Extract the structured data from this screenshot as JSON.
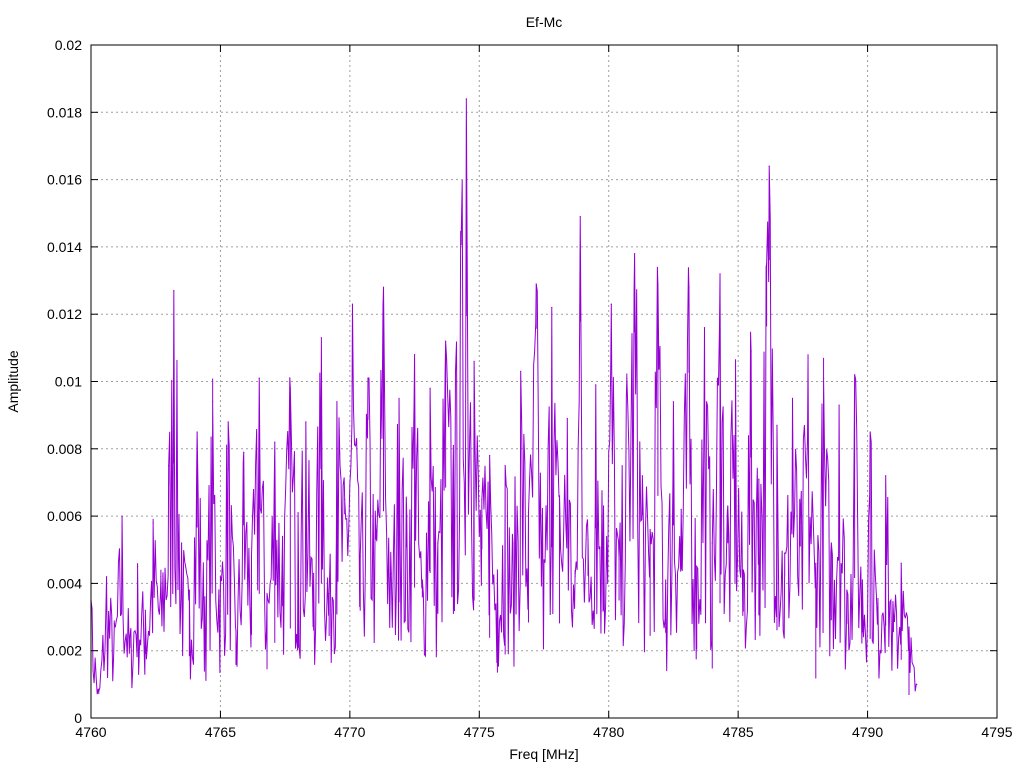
{
  "chart_data": {
    "type": "line",
    "title": "Ef-Mc",
    "xlabel": "Freq [MHz]",
    "ylabel": "Amplitude",
    "xlim": [
      4760,
      4795
    ],
    "ylim": [
      0,
      0.02
    ],
    "xticks": [
      4760,
      4765,
      4770,
      4775,
      4780,
      4785,
      4790,
      4795
    ],
    "xtick_labels": [
      "4760",
      "4765",
      "4770",
      "4775",
      "4780",
      "4785",
      "4790",
      "4795"
    ],
    "yticks": [
      0,
      0.002,
      0.004,
      0.006,
      0.008,
      0.01,
      0.012,
      0.014,
      0.016,
      0.018,
      0.02
    ],
    "ytick_labels": [
      "0",
      "0.002",
      "0.004",
      "0.006",
      "0.008",
      "0.01",
      "0.012",
      "0.014",
      "0.016",
      "0.018",
      "0.02"
    ],
    "grid": true,
    "series_color": "#9400d3",
    "series": [
      {
        "x": [
          4760.0,
          4760.3,
          4760.6,
          4760.9,
          4761.2,
          4761.5,
          4761.8,
          4762.1,
          4762.4,
          4762.7,
          4763.0,
          4763.2,
          4763.5,
          4763.8,
          4764.1,
          4764.4,
          4764.7,
          4765.0,
          4765.3,
          4765.6,
          4765.9,
          4766.2,
          4766.5,
          4766.8,
          4767.1,
          4767.4,
          4767.7,
          4768.0,
          4768.3,
          4768.6,
          4768.9,
          4769.2,
          4769.5,
          4769.8,
          4770.1,
          4770.4,
          4770.7,
          4771.0,
          4771.3,
          4771.6,
          4771.9,
          4772.2,
          4772.5,
          4772.8,
          4773.1,
          4773.4,
          4773.7,
          4774.0,
          4774.3,
          4774.5,
          4774.8,
          4775.1,
          4775.4,
          4775.7,
          4776.0,
          4776.3,
          4776.6,
          4776.9,
          4777.2,
          4777.5,
          4777.8,
          4778.1,
          4778.4,
          4778.7,
          4778.9,
          4779.2,
          4779.5,
          4779.8,
          4780.1,
          4780.4,
          4780.7,
          4781.0,
          4781.3,
          4781.6,
          4781.9,
          4782.2,
          4782.5,
          4782.8,
          4783.1,
          4783.4,
          4783.7,
          4784.0,
          4784.3,
          4784.6,
          4784.9,
          4785.2,
          4785.5,
          4785.8,
          4786.1,
          4786.2,
          4786.5,
          4786.8,
          4787.1,
          4787.4,
          4787.7,
          4788.0,
          4788.3,
          4788.6,
          4788.9,
          4789.2,
          4789.5,
          4789.8,
          4790.1,
          4790.4,
          4790.7,
          4791.0,
          4791.3,
          4791.6,
          4791.9
        ],
        "y": [
          0.0035,
          0.0008,
          0.0042,
          0.0028,
          0.006,
          0.0024,
          0.0045,
          0.0032,
          0.0058,
          0.0042,
          0.0075,
          0.0127,
          0.0052,
          0.0038,
          0.0085,
          0.0036,
          0.0094,
          0.0042,
          0.0088,
          0.0026,
          0.0079,
          0.0048,
          0.0101,
          0.0037,
          0.0082,
          0.0054,
          0.0098,
          0.0061,
          0.0088,
          0.0043,
          0.0113,
          0.0037,
          0.0094,
          0.0065,
          0.0123,
          0.0048,
          0.0101,
          0.0057,
          0.0128,
          0.0043,
          0.0095,
          0.006,
          0.0108,
          0.0041,
          0.0098,
          0.0052,
          0.0112,
          0.0081,
          0.0142,
          0.0184,
          0.0106,
          0.0065,
          0.0078,
          0.0044,
          0.0075,
          0.0052,
          0.0103,
          0.0061,
          0.0129,
          0.0047,
          0.0122,
          0.0066,
          0.0089,
          0.0042,
          0.0149,
          0.0053,
          0.0099,
          0.0063,
          0.0123,
          0.0047,
          0.0101,
          0.0138,
          0.0072,
          0.0056,
          0.0129,
          0.0041,
          0.0094,
          0.0062,
          0.0128,
          0.0045,
          0.0116,
          0.0052,
          0.0132,
          0.0063,
          0.0106,
          0.0044,
          0.0109,
          0.0071,
          0.0135,
          0.0164,
          0.0087,
          0.0049,
          0.0095,
          0.0058,
          0.0107,
          0.0046,
          0.0101,
          0.0052,
          0.0093,
          0.0038,
          0.0102,
          0.0041,
          0.0085,
          0.0034,
          0.0072,
          0.0031,
          0.0046,
          0.0027,
          0.001
        ]
      }
    ]
  }
}
